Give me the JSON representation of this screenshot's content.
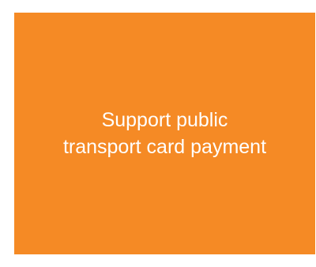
{
  "tile": {
    "background_color": "#F58A25",
    "text_color": "#FFFFFF",
    "lines": [
      "Support public",
      "transport card payment"
    ]
  }
}
